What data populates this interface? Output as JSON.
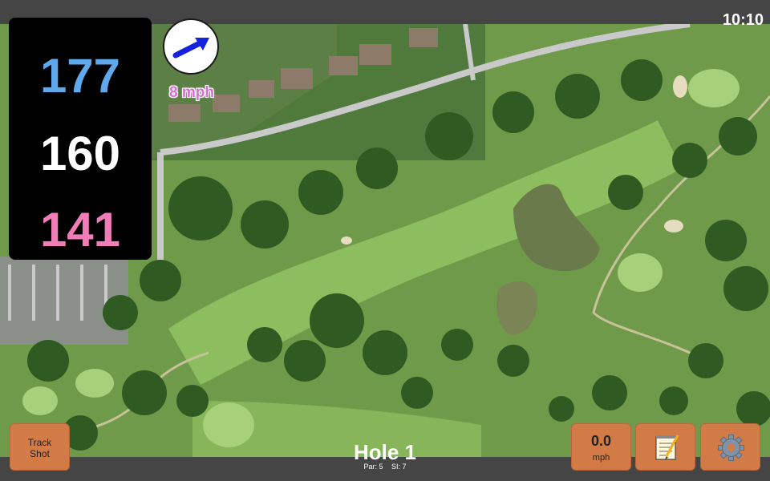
{
  "status": {
    "clock": "10:10"
  },
  "distances": {
    "back": "177",
    "middle": "160",
    "front": "141"
  },
  "wind": {
    "speed_label": "8 mph",
    "arrow_icon": "wind-direction-arrow-icon"
  },
  "buttons": {
    "track_line1": "Track",
    "track_line2": "Shot",
    "speed_value": "0.0",
    "speed_unit": "mph",
    "notes_icon": "notepad-icon",
    "settings_icon": "gear-icon"
  },
  "hole": {
    "title": "Hole 1",
    "par": "Par: 5",
    "stroke_index": "SI: 7"
  },
  "colors": {
    "back_distance": "#5fa8ec",
    "middle_distance": "#ffffff",
    "front_distance": "#f07cb8",
    "wind_text": "#d66fd6",
    "button": "#d27b47"
  }
}
